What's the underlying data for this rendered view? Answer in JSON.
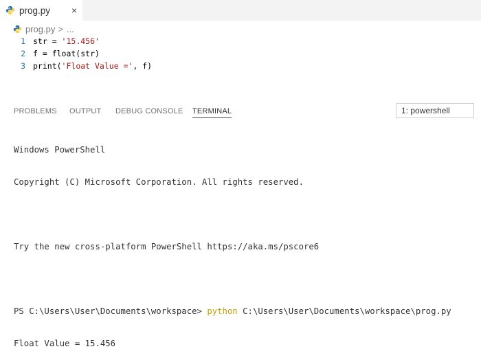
{
  "tab": {
    "filename": "prog.py",
    "close_glyph": "×"
  },
  "breadcrumb": {
    "file": "prog.py",
    "separator": ">",
    "more": "..."
  },
  "editor": {
    "lines": [
      {
        "number": "1",
        "pre": "str = ",
        "string": "'15.456'",
        "post": ""
      },
      {
        "number": "2",
        "pre": "f = float(str)",
        "string": "",
        "post": ""
      },
      {
        "number": "3",
        "pre": "print(",
        "string": "'Float Value ='",
        "post": ", f)"
      }
    ]
  },
  "panel": {
    "tabs": [
      "PROBLEMS",
      "OUTPUT",
      "DEBUG CONSOLE",
      "TERMINAL"
    ],
    "active_tab": "TERMINAL",
    "terminal_select": "1: powershell"
  },
  "terminal": {
    "line1": "Windows PowerShell",
    "line2": "Copyright (C) Microsoft Corporation. All rights reserved.",
    "line3": "",
    "line4": "Try the new cross-platform PowerShell https://aka.ms/pscore6",
    "line5": "",
    "prompt": "PS C:\\Users\\User\\Documents\\workspace> ",
    "command": "python",
    "command_arg": " C:\\Users\\User\\Documents\\workspace\\prog.py",
    "output": "Float Value = 15.456"
  },
  "colors": {
    "line_number": "#237893",
    "string": "#a31515",
    "python_keyword": "#c4a000",
    "python_icon_blue": "#3572a5",
    "python_icon_yellow": "#f7d23e"
  },
  "icons": {
    "tab_icon": "python-file-icon",
    "breadcrumb_icon": "python-file-icon"
  }
}
